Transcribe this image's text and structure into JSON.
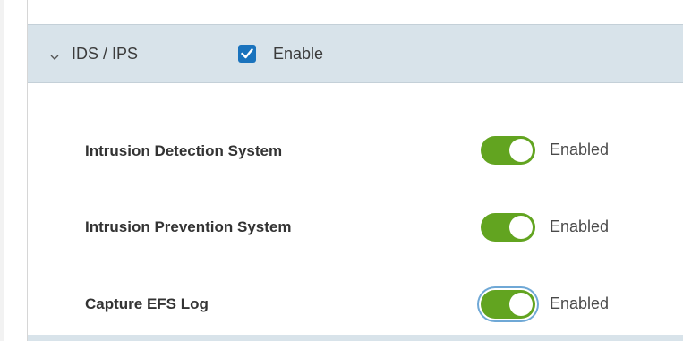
{
  "section": {
    "title": "IDS / IPS",
    "enable_checkbox": {
      "label": "Enable",
      "checked": true
    }
  },
  "settings": [
    {
      "label": "Intrusion Detection System",
      "status": "Enabled",
      "on": true
    },
    {
      "label": "Intrusion Prevention System",
      "status": "Enabled",
      "on": true
    },
    {
      "label": "Capture EFS Log",
      "status": "Enabled",
      "on": true
    }
  ],
  "colors": {
    "header_bg": "#d8e3ea",
    "checkbox_blue": "#1a73bd",
    "toggle_green": "#62a420"
  },
  "icons": {
    "expand": "chevron-down-icon",
    "checkbox": "checkmark-icon"
  }
}
